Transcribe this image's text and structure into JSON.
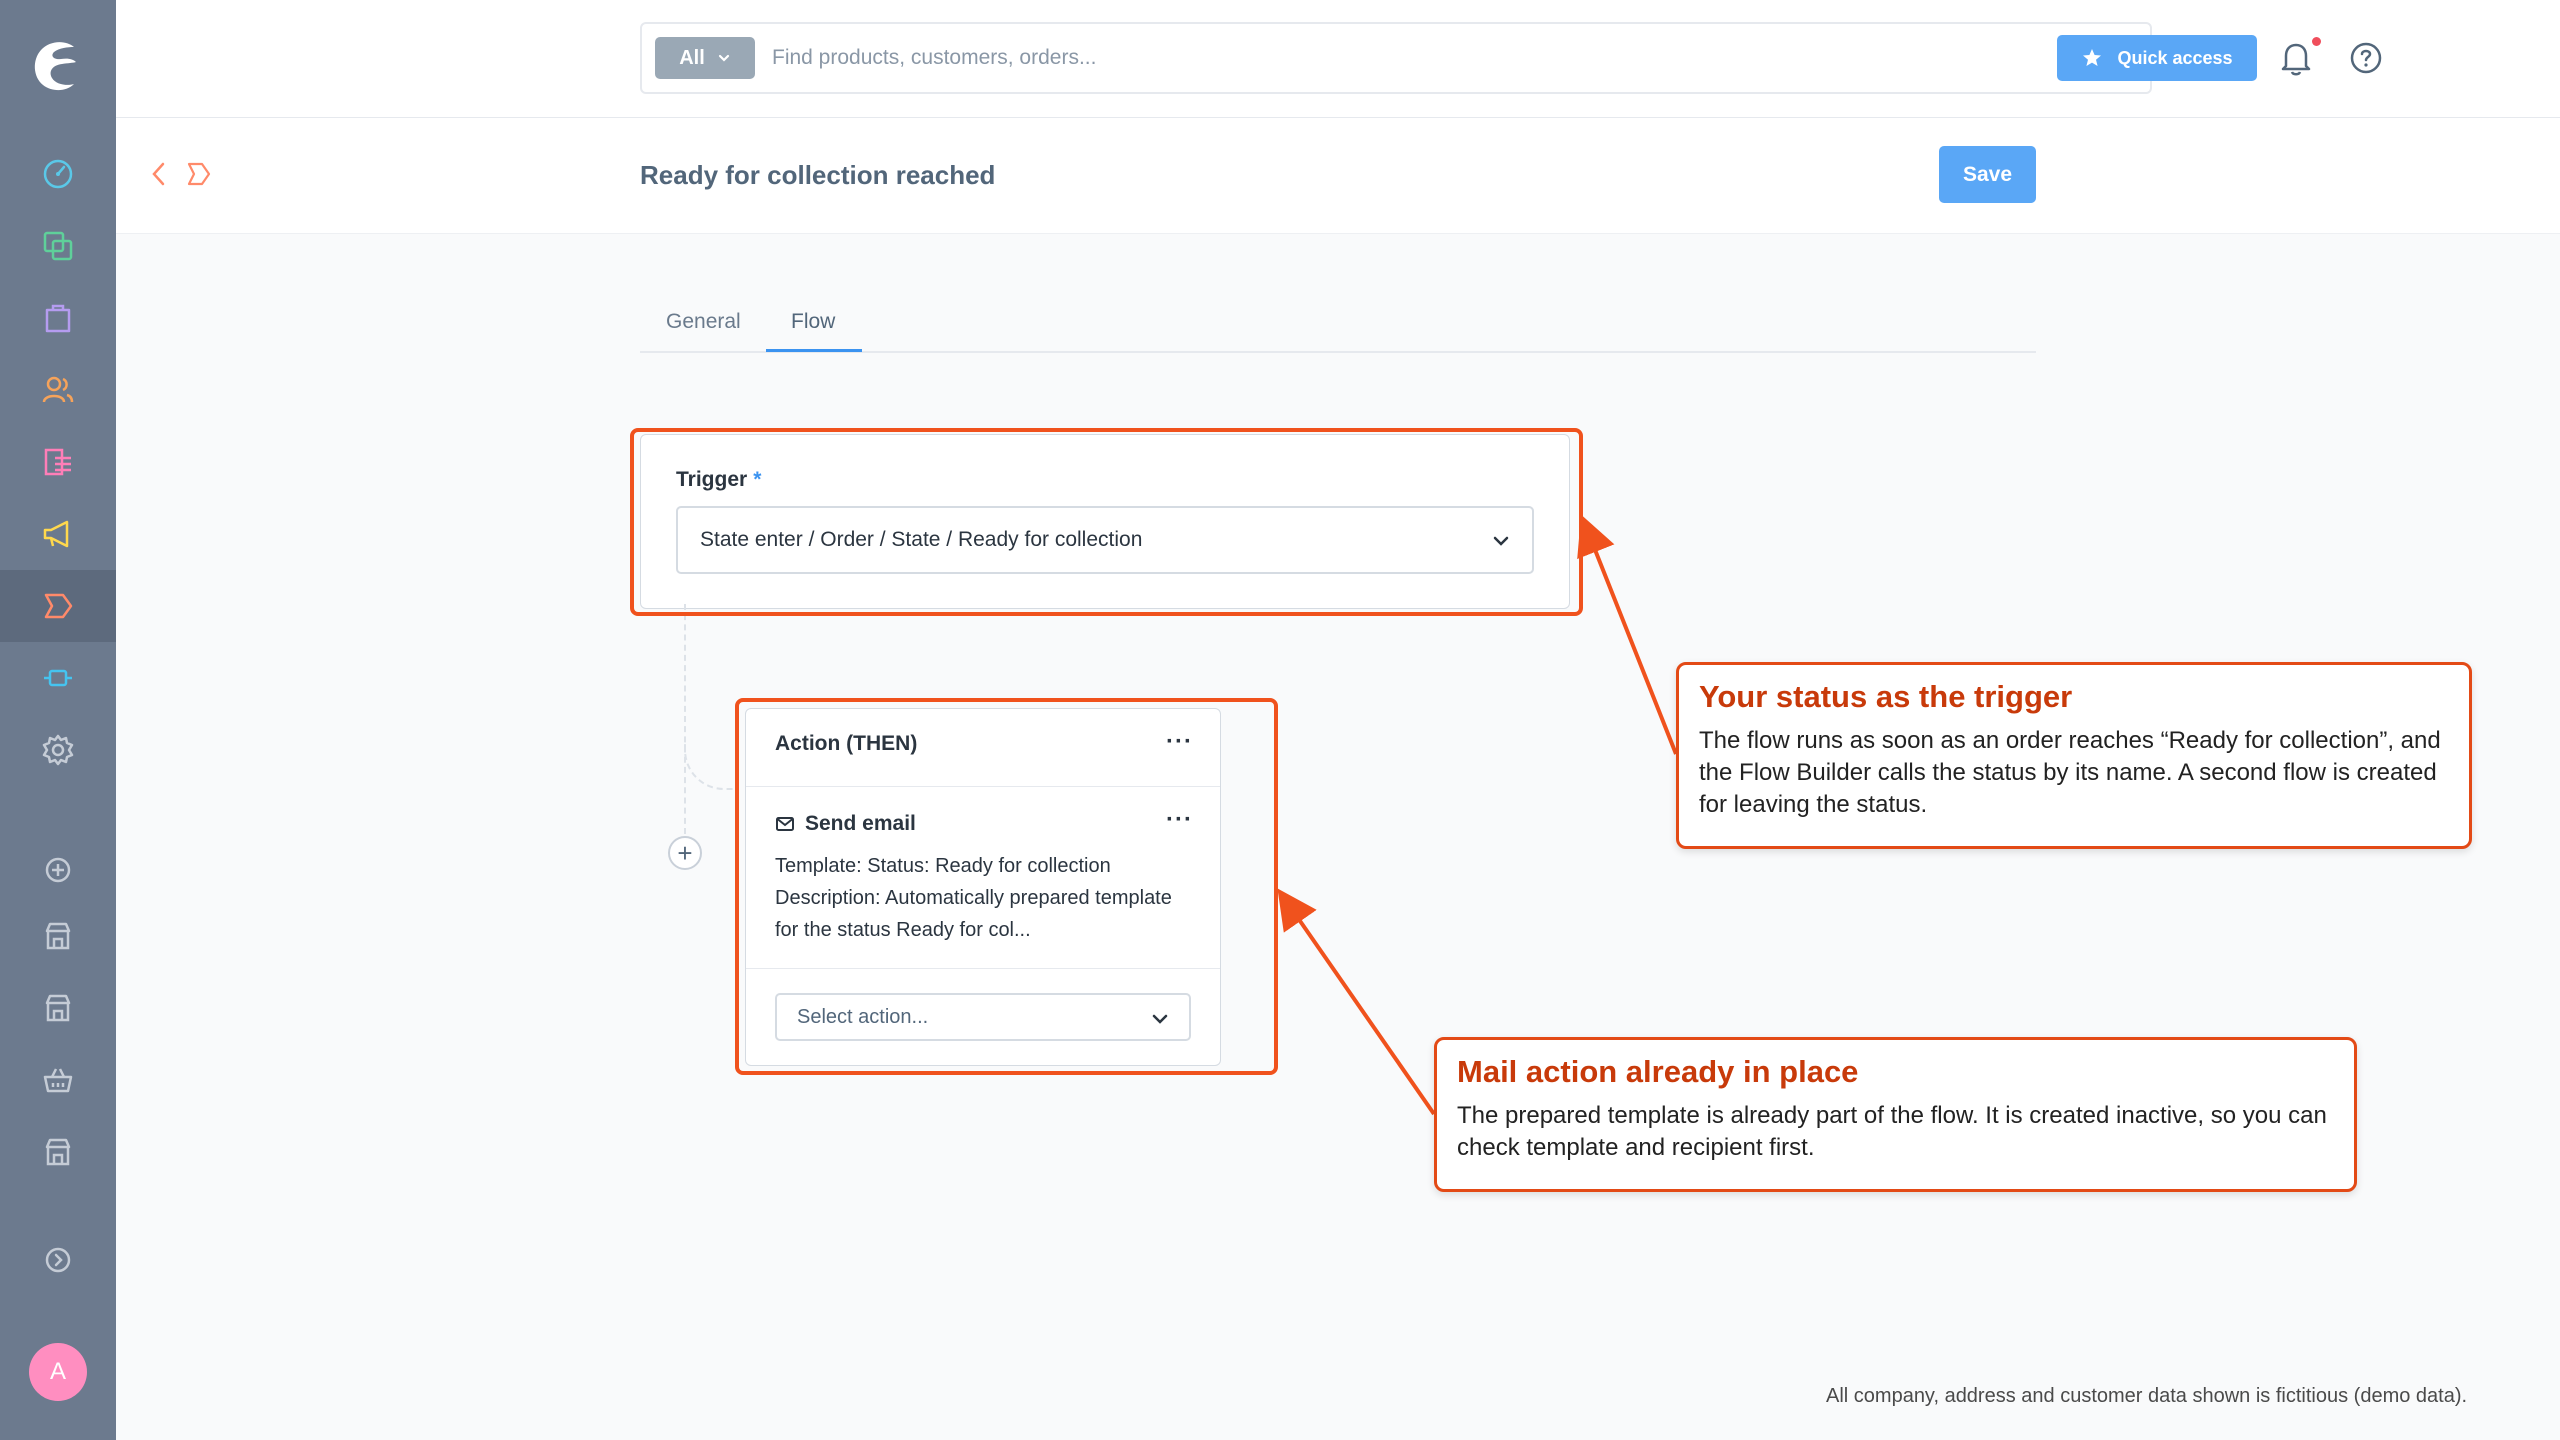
{
  "header": {
    "search_filter": "All",
    "search_placeholder": "Find products, customers, orders...",
    "quick_access_label": "Quick access"
  },
  "page": {
    "title": "Ready for collection reached",
    "save_label": "Save"
  },
  "tabs": [
    {
      "label": "General",
      "active": false
    },
    {
      "label": "Flow",
      "active": true
    }
  ],
  "trigger": {
    "label": "Trigger",
    "required_mark": "*",
    "value": "State enter / Order / State / Ready for collection"
  },
  "action": {
    "title": "Action (THEN)",
    "item_title": "Send email",
    "template_line": "Template: Status: Ready for collection",
    "description_line": "Description: Automatically prepared template for the status Ready for col...",
    "select_placeholder": "Select action..."
  },
  "callouts": [
    {
      "title": "Your status as the trigger",
      "text": "The flow runs as soon as an order reaches “Ready for collection”, and the Flow Builder calls the status by its name. A second flow is created for leaving the status."
    },
    {
      "title": "Mail action already in place",
      "text": "The prepared template is already part of the flow. It is created inactive, so you can check template and recipient first."
    }
  ],
  "user": {
    "avatar_initial": "A"
  },
  "footer_note": "All company, address and customer data shown is fictitious (demo data).",
  "colors": {
    "sidebar": "#6c7a8e",
    "primary": "#5aa7f6",
    "annotation": "#f0521d",
    "callout_title": "#c83a0a",
    "avatar": "#ff8ec0"
  },
  "sidebar_icons": [
    "dashboard-icon",
    "catalogue-icon",
    "orders-icon",
    "customers-icon",
    "content-icon",
    "marketing-icon",
    "flow-builder-icon",
    "extensions-icon",
    "settings-icon",
    "add-sales-channel-icon",
    "sales-channel-icon",
    "sales-channel-icon",
    "headless-channel-icon",
    "sales-channel-icon",
    "expand-icon"
  ]
}
